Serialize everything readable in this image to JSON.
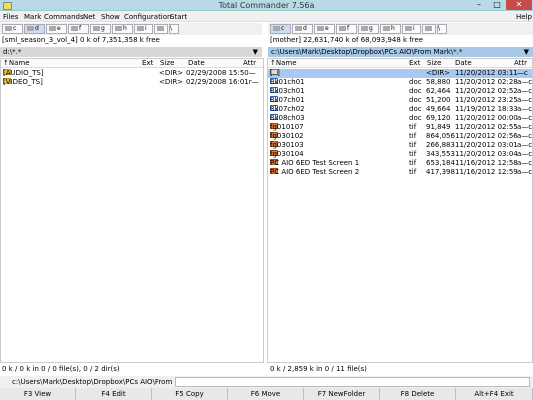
{
  "window": {
    "title": "Total Commander 7.56a",
    "min": "–",
    "max": "□",
    "close": "✕"
  },
  "menu": [
    "Files",
    "Mark",
    "Commands",
    "Net",
    "Show",
    "Configuration",
    "Start"
  ],
  "menu_help": "Help",
  "left": {
    "drives": [
      {
        "letter": "c",
        "selected": false
      },
      {
        "letter": "d",
        "selected": true
      },
      {
        "letter": "e",
        "selected": false
      },
      {
        "letter": "f",
        "selected": false
      },
      {
        "letter": "g",
        "selected": false
      },
      {
        "letter": "h",
        "selected": false
      },
      {
        "letter": "i",
        "selected": false
      }
    ],
    "net_label": "\\",
    "info": "[sml_season_3_vol_4]  0 k of 7,351,358 k free",
    "path": "d:\\*.*",
    "arrow": "▼",
    "columns": {
      "name": "↑Name",
      "ext": "Ext",
      "size": "Size",
      "date": "Date",
      "attr": "Attr"
    },
    "files": [
      {
        "name": "[AUDIO_TS]",
        "ext": "",
        "size": "<DIR>",
        "date": "02/29/2008 15:50—",
        "attr": "",
        "icon": "folder"
      },
      {
        "name": "[VIDEO_TS]",
        "ext": "",
        "size": "<DIR>",
        "date": "02/29/2008 16:01r—",
        "attr": "",
        "icon": "folder"
      }
    ],
    "status": "0 k / 0 k in 0 / 0 file(s), 0 / 2 dir(s)"
  },
  "right": {
    "drives": [
      {
        "letter": "c",
        "selected": true
      },
      {
        "letter": "d",
        "selected": false
      },
      {
        "letter": "e",
        "selected": false
      },
      {
        "letter": "f",
        "selected": false
      },
      {
        "letter": "g",
        "selected": false
      },
      {
        "letter": "h",
        "selected": false
      },
      {
        "letter": "i",
        "selected": false
      }
    ],
    "net_label": "\\",
    "info": "[mother]  22,631,740 k of 68,093,948 k free",
    "path": "c:\\Users\\Mark\\Desktop\\Dropbox\\PCs AIO\\From Mark\\*.*",
    "arrow": "▼",
    "columns": {
      "name": "↑Name",
      "ext": "Ext",
      "size": "Size",
      "date": "Date",
      "attr": "Attr"
    },
    "files": [
      {
        "name": "[..]",
        "ext": "",
        "size": "<DIR>",
        "date": "11/20/2012 03:11—",
        "attr": "—c",
        "icon": "up",
        "selected": true
      },
      {
        "name": "8k01ch01",
        "ext": "doc",
        "size": "58,880",
        "date": "11/20/2012 02:28",
        "attr": "a—c",
        "icon": "doc"
      },
      {
        "name": "8k03ch01",
        "ext": "doc",
        "size": "62,464",
        "date": "11/20/2012 02:52",
        "attr": "a—c",
        "icon": "doc"
      },
      {
        "name": "8k07ch01",
        "ext": "doc",
        "size": "51,200",
        "date": "11/20/2012 23:25",
        "attr": "a—c",
        "icon": "doc"
      },
      {
        "name": "8k07ch02",
        "ext": "doc",
        "size": "49,664",
        "date": "11/19/2012 18:33",
        "attr": "a—c",
        "icon": "doc"
      },
      {
        "name": "8k08ch03",
        "ext": "doc",
        "size": "69,120",
        "date": "11/20/2012 00:00",
        "attr": "a—c",
        "icon": "doc"
      },
      {
        "name": "fg010107",
        "ext": "tif",
        "size": "91,849",
        "date": "11/20/2012 02:55",
        "attr": "a—c",
        "icon": "tif"
      },
      {
        "name": "fg030102",
        "ext": "tif",
        "size": "864,056",
        "date": "11/20/2012 02:56",
        "attr": "a—c",
        "icon": "tif"
      },
      {
        "name": "fg030103",
        "ext": "tif",
        "size": "266,883",
        "date": "11/20/2012 03:01",
        "attr": "a—c",
        "icon": "tif"
      },
      {
        "name": "fg030104",
        "ext": "tif",
        "size": "343,553",
        "date": "11/20/2012 03:04",
        "attr": "a—c",
        "icon": "tif"
      },
      {
        "name": "PC AIO 6ED Test Screen 1",
        "ext": "tif",
        "size": "653,184",
        "date": "11/16/2012 12:58",
        "attr": "a—c",
        "icon": "tif"
      },
      {
        "name": "PC AIO 6ED Test Screen 2",
        "ext": "tif",
        "size": "417,398",
        "date": "11/16/2012 12:59",
        "attr": "a—c",
        "icon": "tif"
      }
    ],
    "status": "0 k / 2,859 k in 0 / 11 file(s)"
  },
  "cmdline": {
    "label": "c:\\Users\\Mark\\Desktop\\Dropbox\\PCs AIO\\From Mark>",
    "value": ""
  },
  "fkeys": [
    "F3 View",
    "F4 Edit",
    "F5 Copy",
    "F6 Move",
    "F7 NewFolder",
    "F8 Delete",
    "Alt+F4 Exit"
  ]
}
